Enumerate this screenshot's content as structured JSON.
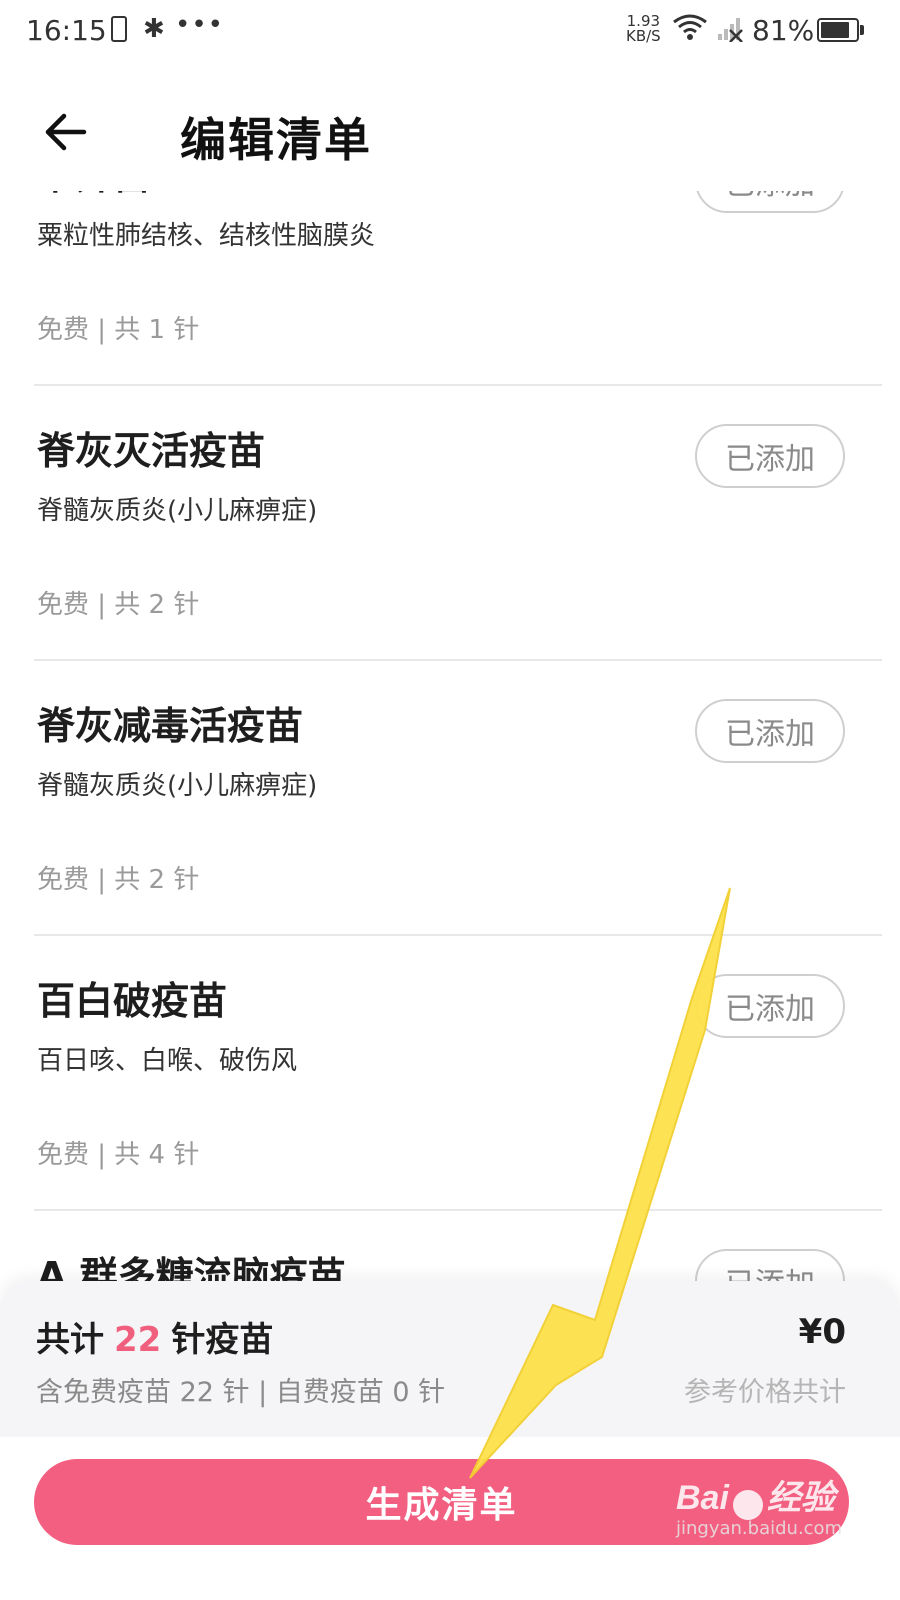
{
  "status_bar": {
    "time": "16:15",
    "speed_value": "1.93",
    "speed_unit": "KB/S",
    "battery_text": "81%",
    "battery_level": 0.81
  },
  "header": {
    "title": "编辑清单"
  },
  "vaccines": [
    {
      "name": "卡介苗",
      "desc": "粟粒性肺结核、结核性脑膜炎",
      "meta": "免费 | 共 1 针",
      "button": "已添加"
    },
    {
      "name": "脊灰灭活疫苗",
      "desc": "脊髓灰质炎(小儿麻痹症)",
      "meta": "免费 | 共 2 针",
      "button": "已添加"
    },
    {
      "name": "脊灰减毒活疫苗",
      "desc": "脊髓灰质炎(小儿麻痹症)",
      "meta": "免费 | 共 2 针",
      "button": "已添加"
    },
    {
      "name": "百白破疫苗",
      "desc": "百日咳、白喉、破伤风",
      "meta": "免费 | 共 4 针",
      "button": "已添加"
    },
    {
      "name": "A 群多糖流脑疫苗",
      "desc": "",
      "meta": "",
      "button": "已添加"
    }
  ],
  "summary": {
    "total_prefix": "共计",
    "total_count": "22",
    "total_suffix": "针疫苗",
    "detail": "含免费疫苗 22 针 | 自费疫苗 0 针",
    "price": "¥0",
    "price_note": "参考价格共计"
  },
  "footer": {
    "generate_label": "生成清单"
  },
  "watermark": {
    "logo": "Bai",
    "logo_suffix": "经验",
    "url": "jingyan.baidu.com"
  },
  "colors": {
    "accent": "#f35f80",
    "highlight_number": "#f0607e",
    "annotation_arrow": "#fde24a"
  }
}
